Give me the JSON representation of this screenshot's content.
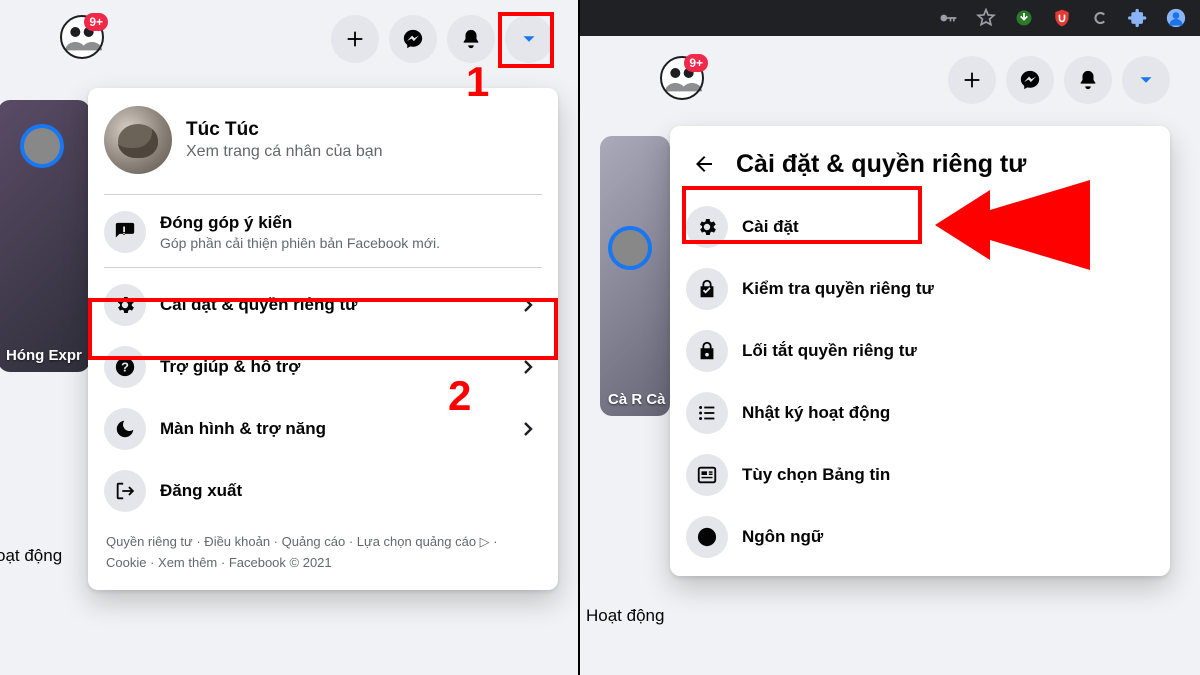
{
  "left": {
    "badge": "9+",
    "profile": {
      "name": "Túc Túc",
      "subtitle": "Xem trang cá nhân của bạn"
    },
    "feedback": {
      "title": "Đóng góp ý kiến",
      "subtitle": "Góp phần cải thiện phiên bản Facebook mới."
    },
    "menu": {
      "settings_privacy": "Cài đặt & quyền riêng tư",
      "help_support": "Trợ giúp & hỗ trợ",
      "display_access": "Màn hình & trợ năng",
      "logout": "Đăng xuất"
    },
    "footer": "Quyền riêng tư · Điều khoản · Quảng cáo · Lựa chọn quảng cáo ▷ · Cookie · Xem thêm · Facebook © 2021",
    "story_label": "Hóng\nExpr",
    "bg_activity": "oạt động",
    "annot1": "1",
    "annot2": "2"
  },
  "right": {
    "badge": "9+",
    "header": "Cài đặt & quyền riêng tư",
    "items": {
      "settings": "Cài đặt",
      "privacy_checkup": "Kiểm tra quyền riêng tư",
      "privacy_shortcuts": "Lối tắt quyền riêng tư",
      "activity_log": "Nhật ký hoạt động",
      "news_feed_prefs": "Tùy chọn Bảng tin",
      "language": "Ngôn ngữ"
    },
    "story_label": "Cà R\nCà",
    "bg_activity": "Hoạt động"
  }
}
